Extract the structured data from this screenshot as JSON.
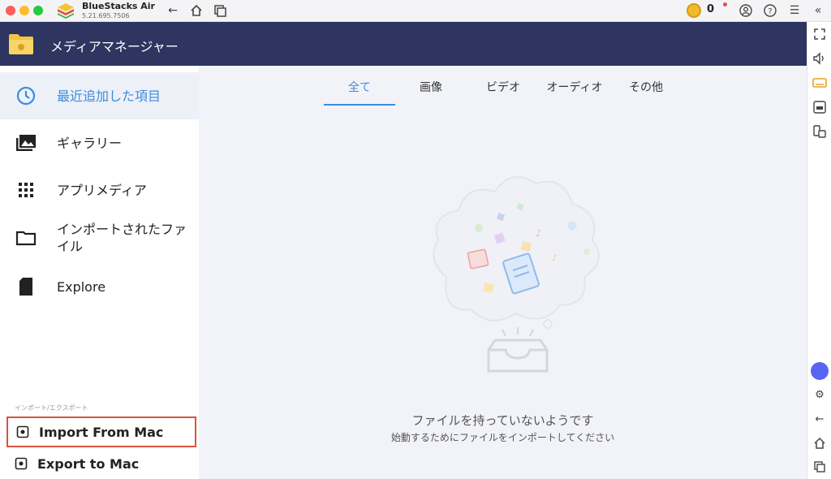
{
  "titlebar": {
    "app_name": "BlueStacks Air",
    "app_version": "5.21.695.7506",
    "coin_count": "0"
  },
  "header": {
    "title": "メディアマネージャー"
  },
  "sidebar": {
    "items": [
      {
        "label": "最近追加した項目",
        "icon": "clock-icon",
        "active": true
      },
      {
        "label": "ギャラリー",
        "icon": "gallery-icon"
      },
      {
        "label": "アプリメディア",
        "icon": "grid-icon"
      },
      {
        "label": "インポートされたファイル",
        "icon": "folder-icon"
      },
      {
        "label": "Explore",
        "icon": "sd-card-icon"
      }
    ],
    "section_caption": "インポート/エクスポート",
    "import_label": "Import From Mac",
    "export_label": "Export to Mac"
  },
  "tabs": [
    {
      "label": "全て",
      "active": true
    },
    {
      "label": "画像"
    },
    {
      "label": "ビデオ"
    },
    {
      "label": "オーディオ"
    },
    {
      "label": "その他"
    }
  ],
  "empty_state": {
    "title": "ファイルを持っていないようです",
    "subtitle": "始動するためにファイルをインポートしてください"
  },
  "colors": {
    "header_bg": "#2d3560",
    "accent": "#3a8de0",
    "highlight_border": "#d9543f"
  }
}
